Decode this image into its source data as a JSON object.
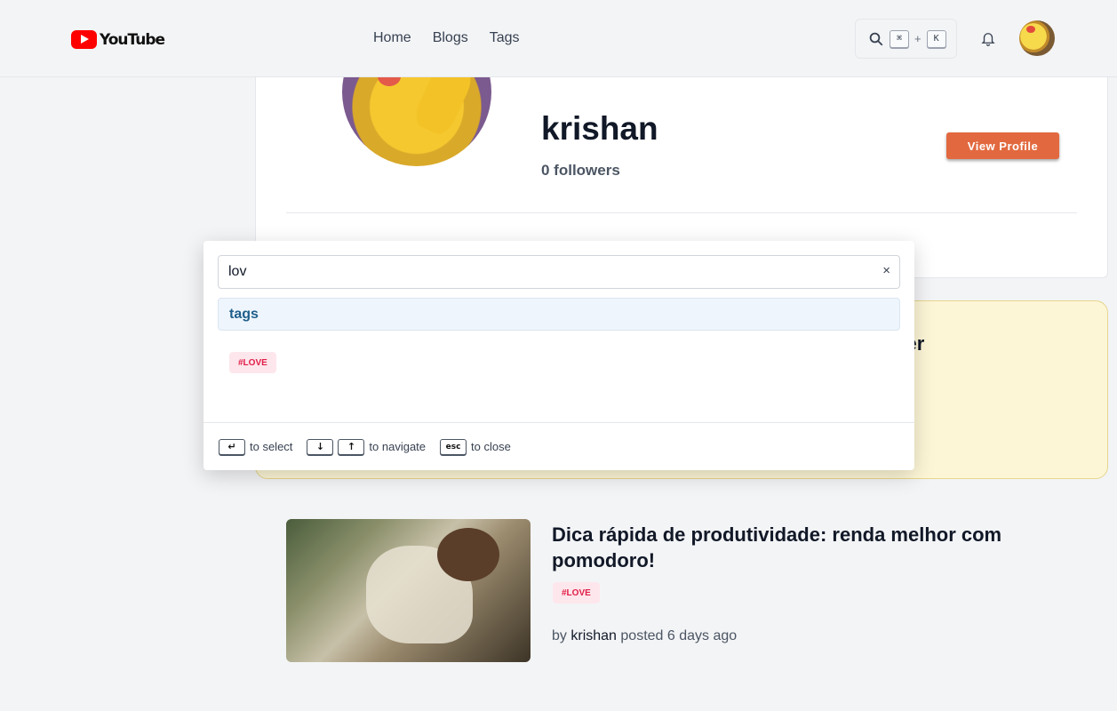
{
  "header": {
    "logo_text": "YouTube",
    "nav": [
      "Home",
      "Blogs",
      "Tags"
    ],
    "search_shortcut": {
      "key1": "⌘",
      "plus": "+",
      "key2": "K"
    }
  },
  "profile": {
    "name": "krishan",
    "followers": "0 followers",
    "view_profile_label": "View Profile"
  },
  "highlight_post": {
    "title_fragment": "ster"
  },
  "post": {
    "title": "Dica rápida de produtividade: renda melhor com pomodoro!",
    "tag": "#LOVE",
    "by": "by",
    "author": "krishan",
    "posted": "posted 6 days ago"
  },
  "search_modal": {
    "query": "lov",
    "clear_glyph": "×",
    "section_label": "tags",
    "results": [
      "#LOVE"
    ],
    "footer": {
      "select_key": "↵",
      "select_text": "to select",
      "down_key": "↓",
      "up_key": "↑",
      "navigate_text": "to navigate",
      "esc_key": "esc",
      "close_text": "to close"
    }
  },
  "colors": {
    "accent_button": "#e2693f",
    "tag_bg": "#fde7ec",
    "tag_text": "#e11d48",
    "section_text": "#1f5f8b",
    "highlight_card_bg": "#fdf6d6"
  }
}
